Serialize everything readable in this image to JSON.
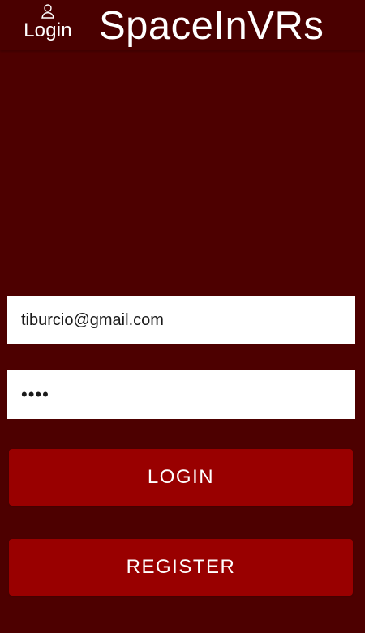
{
  "app": {
    "title": "SpaceInVRs"
  },
  "header": {
    "login_label": "Login",
    "login_icon": "user-icon"
  },
  "form": {
    "email_value": "tiburcio@gmail.com",
    "password_value": "1234"
  },
  "actions": {
    "login_label": "LOGIN",
    "register_label": "REGISTER"
  },
  "colors": {
    "background": "#4d0000",
    "button": "#990000",
    "input_background": "#ffffff",
    "text": "#ffffff"
  }
}
